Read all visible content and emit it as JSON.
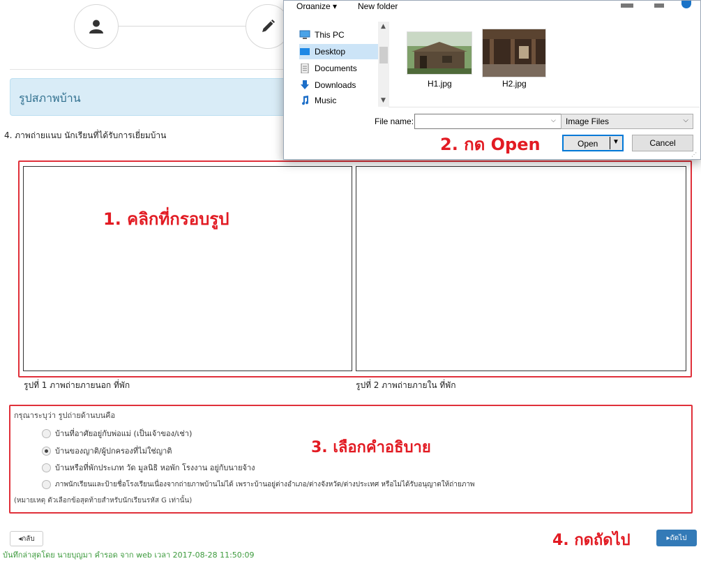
{
  "form": {
    "section_title": "รูปสภาพบ้าน",
    "question_label": "4.  ภาพถ่ายแนบ นักเรียนที่ได้รับการเยี่ยมบ้าน",
    "photo1_caption": "รูปที่ 1 ภาพถ่ายภายนอก ที่พัก",
    "photo2_caption": "รูปที่ 2 ภาพถ่ายภายใน ที่พัก",
    "radio_prompt": "กรุณาระบุว่า รูปถ่ายด้านบนคือ",
    "options": [
      {
        "label": "บ้านที่อาศัยอยู่กับพ่อแม่ (เป็นเจ้าของ/เช่า)",
        "checked": false
      },
      {
        "label": "บ้านของญาติ/ผู้ปกครองที่ไม่ใช่ญาติ",
        "checked": true
      },
      {
        "label": "บ้านหรือที่พักประเภท วัด มูลนิธิ หอพัก โรงงาน อยู่กับนายจ้าง",
        "checked": false
      },
      {
        "label": "ภาพนักเรียนและป้ายชื่อโรงเรียนเนื่องจากถ่ายภาพบ้านไม่ได้ เพราะบ้านอยู่ต่างอำเภอ/ต่างจังหวัด/ต่างประเทศ หรือไม่ได้รับอนุญาตให้ถ่ายภาพ",
        "checked": false
      }
    ],
    "option_note": "(หมายเหตุ ตัวเลือกข้อสุดท้ายสำหรับนักเรียนรหัส G เท่านั้น)",
    "back_label": "◂กลับ",
    "next_label": "▸ถัดไป",
    "footer_note": "บันทึกล่าสุดโดย นายบุญมา คำรอด จาก web เวลา 2017-08-28 11:50:09"
  },
  "annotations": {
    "step1": "1. คลิกที่กรอบรูป",
    "step2": "2. กด Open",
    "step3": "3. เลือกคำอธิบาย",
    "step4": "4. กดถัดไป"
  },
  "dialog": {
    "toolbar_organize": "Organize ▾",
    "toolbar_new_folder": "New folder",
    "nav_items": [
      {
        "label": "This PC",
        "icon": "computer-icon"
      },
      {
        "label": "Desktop",
        "icon": "desktop-folder-icon",
        "selected": true
      },
      {
        "label": "Documents",
        "icon": "documents-icon"
      },
      {
        "label": "Downloads",
        "icon": "downloads-icon"
      },
      {
        "label": "Music",
        "icon": "music-icon"
      }
    ],
    "files": [
      {
        "name": "H1.jpg"
      },
      {
        "name": "H2.jpg"
      }
    ],
    "file_name_label": "File name:",
    "file_name_value": "",
    "file_type_filter": "Image Files",
    "open_label": "Open",
    "cancel_label": "Cancel"
  },
  "colors": {
    "annotation_red": "#e21b23",
    "panel_bg": "#d9ecf7",
    "primary_button": "#337ab7",
    "footer_green": "#3c9a3c"
  }
}
